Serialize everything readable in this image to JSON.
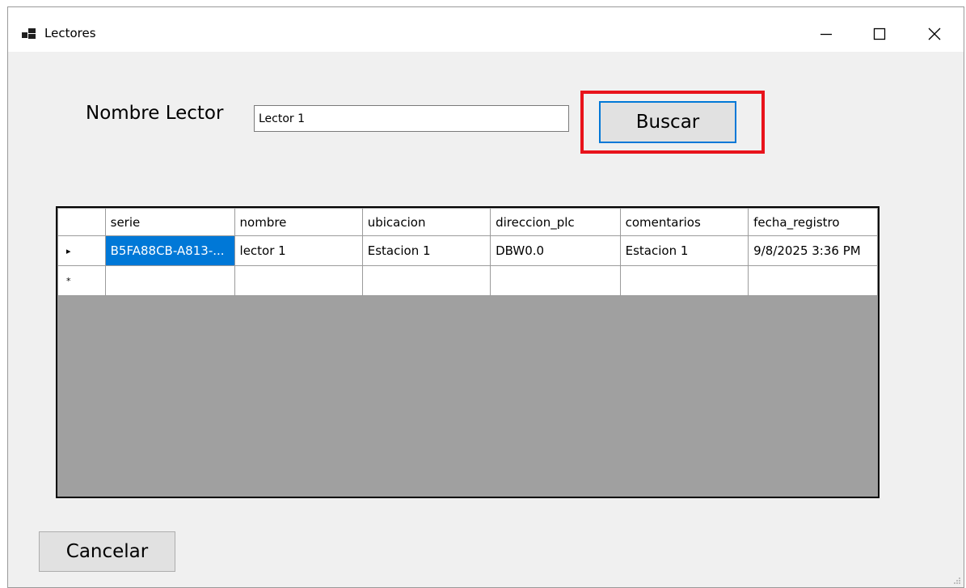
{
  "window": {
    "title": "Lectores",
    "icon": "app-window-icon",
    "controls": {
      "minimize": "minimize-icon",
      "maximize": "maximize-icon",
      "close": "close-icon"
    }
  },
  "search": {
    "label": "Nombre Lector",
    "value": "Lector 1",
    "button_label": "Buscar"
  },
  "grid": {
    "columns": [
      "serie",
      "nombre",
      "ubicacion",
      "direccion_plc",
      "comentarios",
      "fecha_registro"
    ],
    "rows": [
      {
        "marker": "▸",
        "cells": [
          "B5FA88CB-A813-...",
          "lector 1",
          "Estacion 1",
          "DBW0.0",
          "Estacion 1",
          "9/8/2025 3:36 PM"
        ]
      }
    ],
    "new_row_marker": "*"
  },
  "footer": {
    "cancel_label": "Cancelar"
  },
  "colors": {
    "highlight": "#e8131b",
    "selection": "#0078d7",
    "grid_background": "#a0a0a0",
    "window_background": "#f0f0f0"
  }
}
